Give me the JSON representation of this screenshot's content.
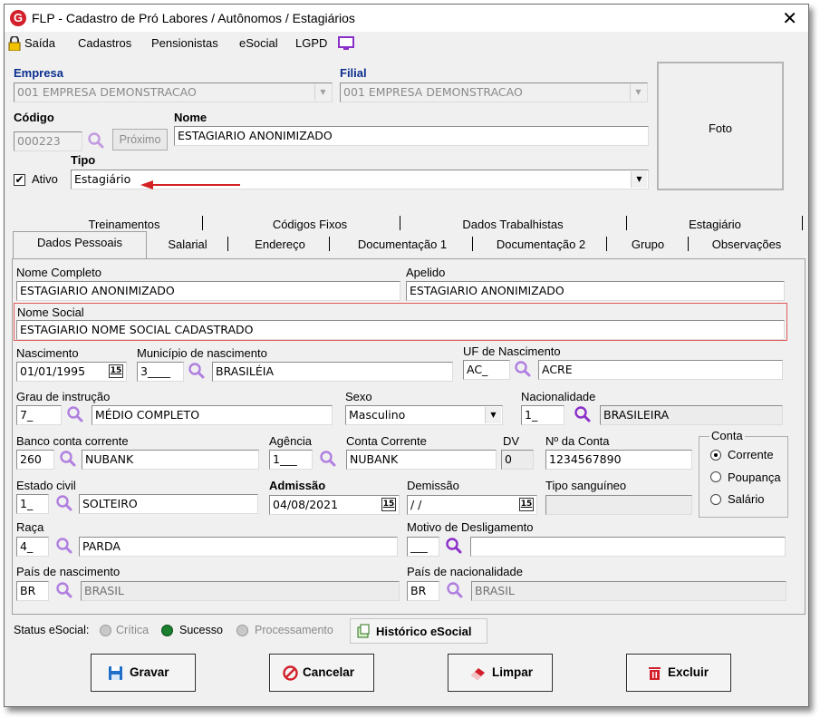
{
  "window": {
    "title": "FLP - Cadastro de Pró Labores / Autônomos / Estagiários",
    "close_glyph": "✕"
  },
  "menu": {
    "saida": "Saída",
    "cadastros": "Cadastros",
    "pensionistas": "Pensionistas",
    "esocial": "eSocial",
    "lgpd": "LGPD"
  },
  "header": {
    "empresa_label": "Empresa",
    "empresa_value": "001 EMPRESA DEMONSTRACAO",
    "filial_label": "Filial",
    "filial_value": "001 EMPRESA DEMONSTRACAO",
    "codigo_label": "Código",
    "codigo_value": "000223",
    "proximo_label": "Próximo",
    "nome_label": "Nome",
    "nome_value": "ESTAGIARIO ANONIMIZADO",
    "ativo_label": "Ativo",
    "ativo_checked": true,
    "tipo_label": "Tipo",
    "tipo_value": "Estagiário",
    "foto_label": "Foto"
  },
  "tabs": {
    "row1": [
      "Treinamentos",
      "Códigos Fixos",
      "Dados Trabalhistas",
      "Estagiário"
    ],
    "row2": [
      "Dados Pessoais",
      "Salarial",
      "Endereço",
      "Documentação 1",
      "Documentação 2",
      "Grupo",
      "Observações"
    ],
    "active": "Dados Pessoais"
  },
  "form": {
    "nome_completo_label": "Nome Completo",
    "nome_completo": "ESTAGIARIO ANONIMIZADO",
    "apelido_label": "Apelido",
    "apelido": "ESTAGIARIO  ANONIMIZADO",
    "nome_social_label": "Nome Social",
    "nome_social": "ESTAGIARIO NOME SOCIAL CADASTRADO",
    "nascimento_label": "Nascimento",
    "nascimento": "01/01/1995",
    "municipio_label": "Município de nascimento",
    "municipio_code": "3____",
    "municipio": "BRASILÉIA",
    "uf_label": "UF de Nascimento",
    "uf_code": "AC_",
    "uf": "ACRE",
    "grau_label": "Grau de instrução",
    "grau_code": "7_",
    "grau": "MÉDIO COMPLETO",
    "sexo_label": "Sexo",
    "sexo": "Masculino",
    "nacionalidade_label": "Nacionalidade",
    "nacionalidade_code": "1_",
    "nacionalidade": "BRASILEIRA",
    "banco_label": "Banco conta corrente",
    "banco_code": "260",
    "banco": "NUBANK",
    "agencia_label": "Agência",
    "agencia": "1___",
    "conta_corrente_label": "Conta Corrente",
    "conta_corrente": "NUBANK",
    "dv_label": "DV",
    "dv": "0",
    "num_conta_label": "Nº da Conta",
    "num_conta": "1234567890",
    "conta_group_label": "Conta",
    "conta_options": [
      "Corrente",
      "Poupança",
      "Salário"
    ],
    "conta_selected": "Corrente",
    "estado_civil_label": "Estado civil",
    "estado_civil_code": "1_",
    "estado_civil": "SOLTEIRO",
    "admissao_label": "Admissão",
    "admissao": "04/08/2021",
    "demissao_label": "Demissão",
    "demissao": " / /",
    "tipo_sanguineo_label": "Tipo sanguíneo",
    "tipo_sanguineo": "",
    "raca_label": "Raça",
    "raca_code": "4_",
    "raca": "PARDA",
    "motivo_label": "Motivo de Desligamento",
    "motivo_code": "___",
    "motivo": "",
    "pais_nasc_label": "País de nascimento",
    "pais_nasc_code": "BR",
    "pais_nasc": "BRASIL",
    "pais_nac_label": "País de nacionalidade",
    "pais_nac_code": "BR",
    "pais_nac": "BRASIL"
  },
  "status": {
    "label": "Status eSocial:",
    "critica": "Crítica",
    "sucesso": "Sucesso",
    "processamento": "Processamento",
    "historico": "Histórico eSocial",
    "colors": {
      "sucesso": "#1a7f2e",
      "inactive": "#b8b8b8"
    }
  },
  "buttons": {
    "gravar": "Gravar",
    "cancelar": "Cancelar",
    "limpar": "Limpar",
    "excluir": "Excluir"
  },
  "colors": {
    "label_blue": "#0b2f8f",
    "highlight": "#e05a5a",
    "arrow": "#d32020",
    "magnifier": "#8b2fc9"
  }
}
